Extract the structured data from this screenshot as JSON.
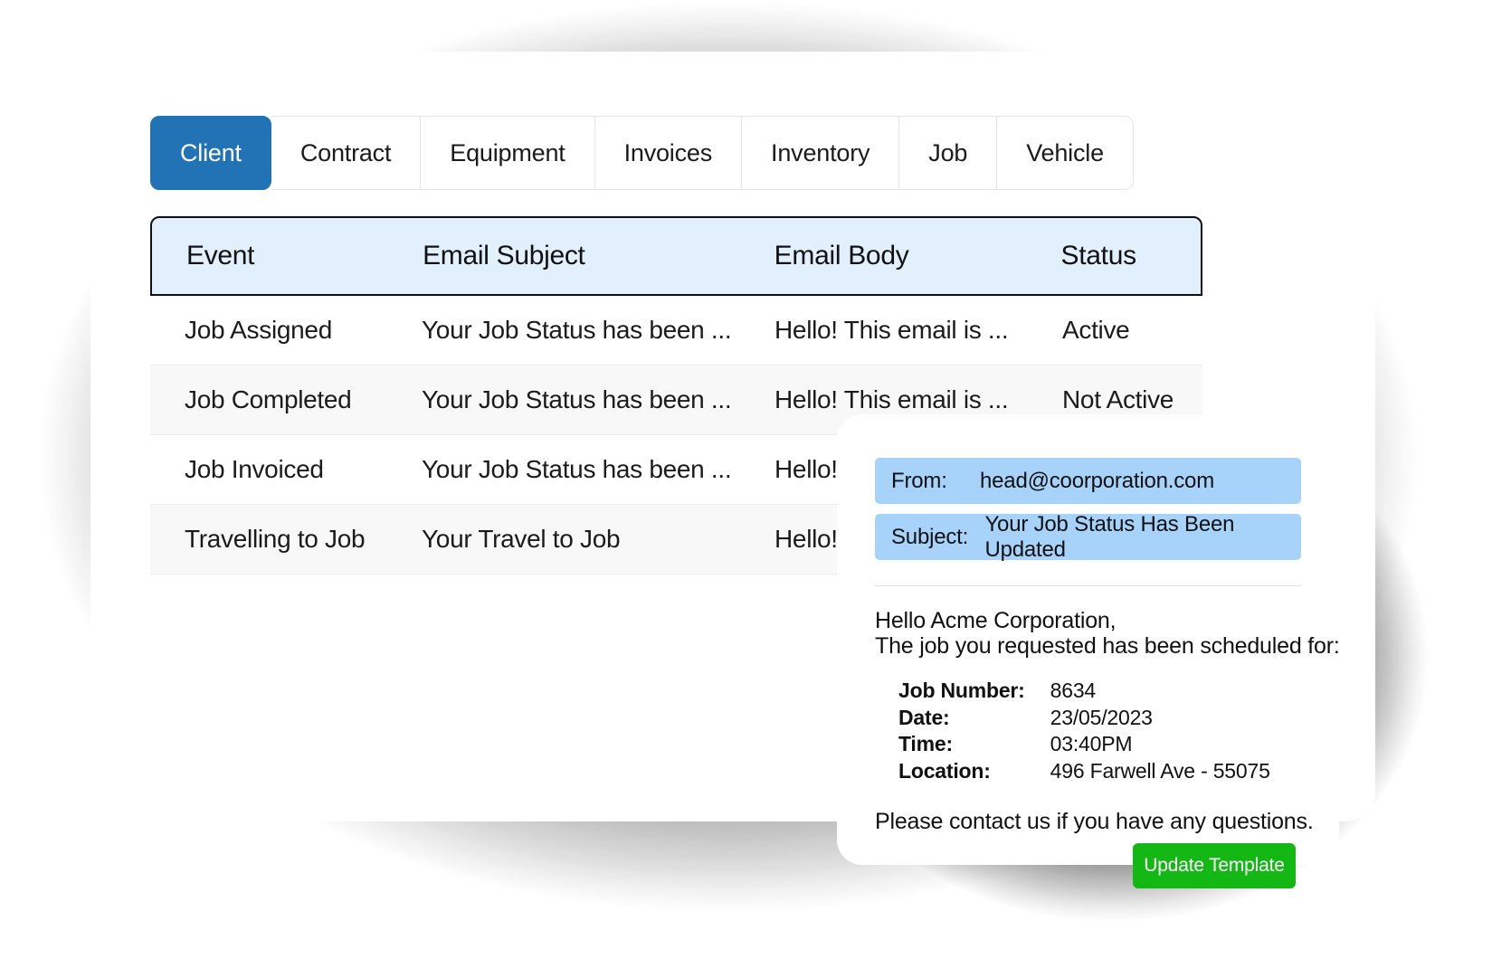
{
  "window": {
    "tabs": [
      {
        "label": "Client",
        "active": true
      },
      {
        "label": "Contract",
        "active": false
      },
      {
        "label": "Equipment",
        "active": false
      },
      {
        "label": "Invoices",
        "active": false
      },
      {
        "label": "Inventory",
        "active": false
      },
      {
        "label": "Job",
        "active": false
      },
      {
        "label": "Vehicle",
        "active": false
      }
    ],
    "table": {
      "columns": [
        "Event",
        "Email Subject",
        "Email Body",
        "Status"
      ],
      "rows": [
        {
          "event": "Job Assigned",
          "subject": "Your Job Status has been ...",
          "body": "Hello! This email is ...",
          "status": "Active"
        },
        {
          "event": "Job Completed",
          "subject": "Your Job Status has been ...",
          "body": "Hello! This email is ...",
          "status": "Not Active"
        },
        {
          "event": "Job Invoiced",
          "subject": "Your Job Status has been ...",
          "body": "Hello!",
          "status": ""
        },
        {
          "event": "Travelling to Job",
          "subject": "Your Travel to Job",
          "body": "Hello!",
          "status": ""
        }
      ]
    }
  },
  "email_preview": {
    "from_label": "From:",
    "from_value": "head@coorporation.com",
    "subject_label": "Subject:",
    "subject_value": "Your Job Status Has Been Updated",
    "greeting": "Hello Acme Corporation,",
    "intro": "The job you requested has been scheduled for:",
    "details": [
      {
        "key": "Job Number:",
        "value": "8634"
      },
      {
        "key": "Date:",
        "value": "23/05/2023"
      },
      {
        "key": "Time:",
        "value": "03:40PM"
      },
      {
        "key": "Location:",
        "value": "496 Farwell Ave - 55075"
      }
    ],
    "closing": "Please contact us if you have any questions."
  },
  "actions": {
    "update_template_label": "Update Template"
  },
  "colors": {
    "tab_active": "#2273b5",
    "table_header": "#e2f0fd",
    "email_field": "#a7d3fb",
    "update_button": "#14b814"
  }
}
